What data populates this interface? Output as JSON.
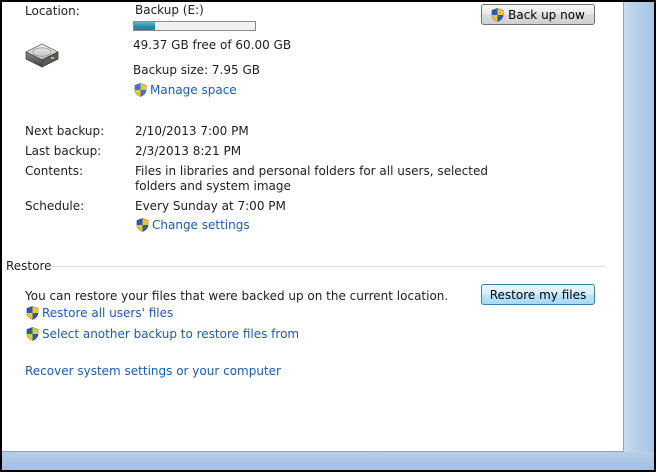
{
  "backup": {
    "location_label": "Location:",
    "drive_name": "Backup (E:)",
    "drive_usage_fraction": 0.177,
    "free_space": "49.37 GB free of 60.00 GB",
    "backup_size": "Backup size: 7.95 GB",
    "manage_space_link": "Manage space",
    "back_up_now_button": "Back up now",
    "next_backup_label": "Next backup:",
    "next_backup_value": "2/10/2013 7:00 PM",
    "last_backup_label": "Last backup:",
    "last_backup_value": "2/3/2013 8:21 PM",
    "contents_label": "Contents:",
    "contents_line1": "Files in libraries and personal folders for all users, selected",
    "contents_line2": "folders and system image",
    "schedule_label": "Schedule:",
    "schedule_value": "Every Sunday at 7:00 PM",
    "change_settings_link": "Change settings"
  },
  "restore": {
    "section_title": "Restore",
    "description": "You can restore your files that were backed up on the current location.",
    "restore_my_files_button": "Restore my files",
    "restore_all_users_link": "Restore all users' files",
    "select_another_backup_link": "Select another backup to restore files from",
    "recover_system_link": "Recover system settings or your computer"
  },
  "icons": {
    "drive": "hard-drive-icon",
    "uac": "uac-shield-icon"
  },
  "colors": {
    "link": "#1a5cb5",
    "progress": "#2e8aa6",
    "frame_blue": "#a7c4e4"
  }
}
